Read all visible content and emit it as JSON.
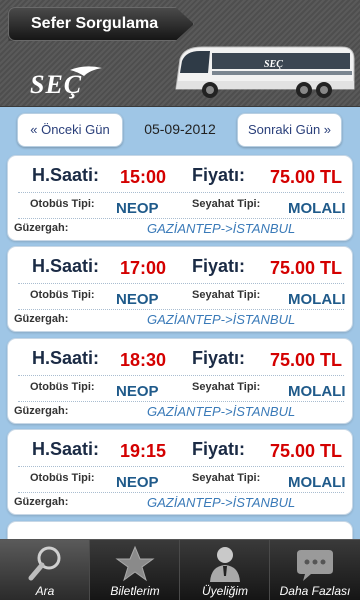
{
  "header": {
    "title": "Sefer Sorgulama",
    "logo_text": "SEÇ",
    "bus_logo_text": "SEÇ"
  },
  "datebar": {
    "prev_label": "« Önceki Gün",
    "date": "05-09-2012",
    "next_label": "Sonraki Gün »"
  },
  "labels": {
    "time": "H.Saati:",
    "price": "Fiyatı:",
    "bus_type": "Otobüs Tipi:",
    "trip_type": "Seyahat Tipi:",
    "route": "Güzergah:"
  },
  "trips": [
    {
      "time": "15:00",
      "price": "75.00 TL",
      "bus_type": "NEOP",
      "trip_type": "MOLALI",
      "route": "GAZİANTEP->İSTANBUL"
    },
    {
      "time": "17:00",
      "price": "75.00 TL",
      "bus_type": "NEOP",
      "trip_type": "MOLALI",
      "route": "GAZİANTEP->İSTANBUL"
    },
    {
      "time": "18:30",
      "price": "75.00 TL",
      "bus_type": "NEOP",
      "trip_type": "MOLALI",
      "route": "GAZİANTEP->İSTANBUL"
    },
    {
      "time": "19:15",
      "price": "75.00 TL",
      "bus_type": "NEOP",
      "trip_type": "MOLALI",
      "route": "GAZİANTEP->İSTANBUL"
    }
  ],
  "tabs": [
    {
      "label": "Ara",
      "icon": "magnifier-icon"
    },
    {
      "label": "Biletlerim",
      "icon": "star-icon"
    },
    {
      "label": "Üyeliğim",
      "icon": "person-icon"
    },
    {
      "label": "Daha Fazlası",
      "icon": "speech-bubble-icon"
    }
  ],
  "colors": {
    "price": "#d40000",
    "value": "#1f5a8a",
    "route": "#3a7ab8",
    "background": "#9fc6e6"
  }
}
